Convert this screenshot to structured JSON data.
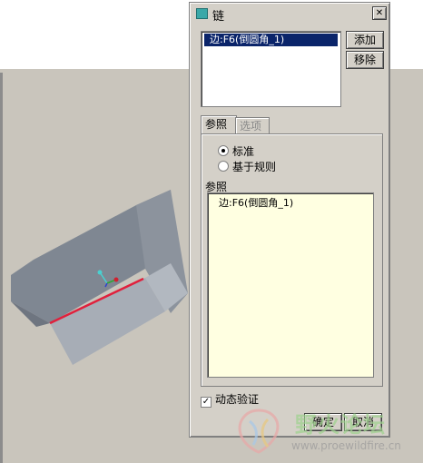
{
  "dialog": {
    "title": "链",
    "close_glyph": "✕",
    "reference_list_item": "边:F6(倒圆角_1)",
    "add_label": "添加",
    "remove_label": "移除",
    "tabs": [
      {
        "label": "参照",
        "active": true
      },
      {
        "label": "选项",
        "active": false
      }
    ],
    "radio_standard": "标准",
    "radio_rule": "基于规则",
    "references_label": "参照",
    "references_item": "边:F6(倒圆角_1)",
    "dynamic_verify_label": "动态验证",
    "dynamic_verify_checked": true,
    "check_glyph": "✓",
    "ok_label": "确定",
    "cancel_label": "取消"
  },
  "watermark": {
    "title": "野火论坛",
    "url": "www.proewildfire.cn"
  },
  "colors": {
    "dialog_bg": "#d4d0c8",
    "selection": "#0a246a",
    "references_bg": "#ffffe1",
    "model_gray": "#7e8693",
    "highlight_edge": "#e0203c"
  }
}
